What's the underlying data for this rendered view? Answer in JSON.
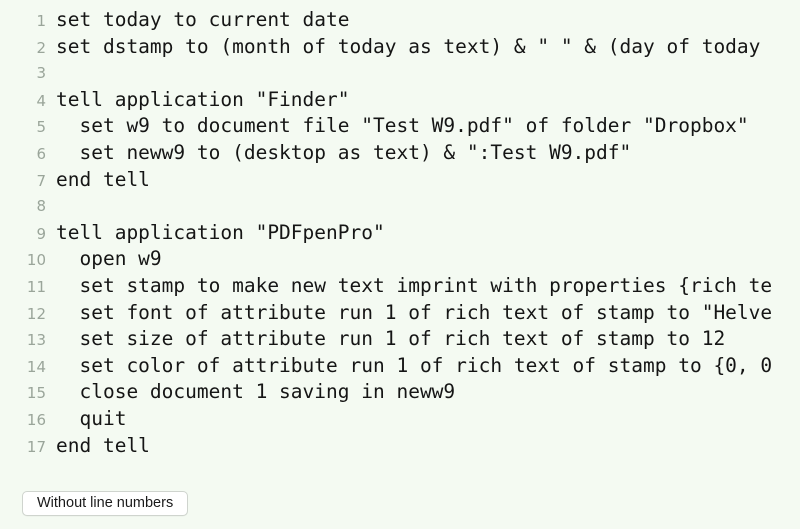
{
  "editor": {
    "background_color": "#f4faf2",
    "text_color": "#151515",
    "line_number_color": "#9aa59a",
    "language": "AppleScript",
    "line_numbers_visible": true,
    "lines": [
      {
        "number": "1",
        "text": "set today to current date"
      },
      {
        "number": "2",
        "text": "set dstamp to (month of today as text) & \" \" & (day of today"
      },
      {
        "number": "3",
        "text": ""
      },
      {
        "number": "4",
        "text": "tell application \"Finder\""
      },
      {
        "number": "5",
        "text": "  set w9 to document file \"Test W9.pdf\" of folder \"Dropbox\""
      },
      {
        "number": "6",
        "text": "  set neww9 to (desktop as text) & \":Test W9.pdf\""
      },
      {
        "number": "7",
        "text": "end tell"
      },
      {
        "number": "8",
        "text": ""
      },
      {
        "number": "9",
        "text": "tell application \"PDFpenPro\""
      },
      {
        "number": "10",
        "text": "  open w9"
      },
      {
        "number": "11",
        "text": "  set stamp to make new text imprint with properties {rich te"
      },
      {
        "number": "12",
        "text": "  set font of attribute run 1 of rich text of stamp to \"Helve"
      },
      {
        "number": "13",
        "text": "  set size of attribute run 1 of rich text of stamp to 12"
      },
      {
        "number": "14",
        "text": "  set color of attribute run 1 of rich text of stamp to {0, 0"
      },
      {
        "number": "15",
        "text": "  close document 1 saving in neww9"
      },
      {
        "number": "16",
        "text": "  quit"
      },
      {
        "number": "17",
        "text": "end tell"
      }
    ]
  },
  "toolbar": {
    "toggle_line_numbers_label": "Without line numbers"
  }
}
